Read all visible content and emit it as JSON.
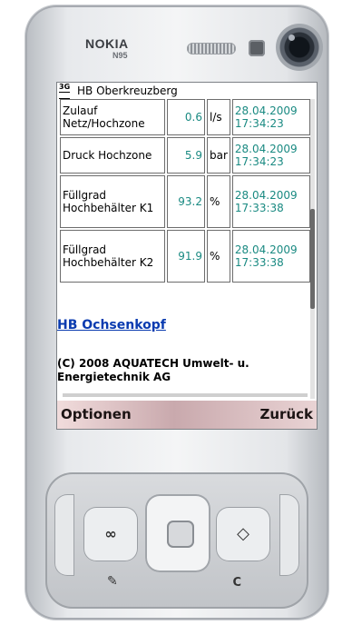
{
  "device": {
    "brand": "NOKIA",
    "model": "N95"
  },
  "screen": {
    "network_label": "3G",
    "title": "HB Oberkreuzberg",
    "rows": [
      {
        "name": "Zulauf Netz/Hochzone",
        "value": "0.6",
        "unit": "l/s",
        "timestamp": "28.04.2009 17:34:23"
      },
      {
        "name": "Druck Hochzone",
        "value": "5.9",
        "unit": "bar",
        "timestamp": "28.04.2009 17:34:23"
      },
      {
        "name": "Füllgrad Hochbehälter K1",
        "value": "93.2",
        "unit": "%",
        "timestamp": "28.04.2009 17:33:38"
      },
      {
        "name": "Füllgrad Hochbehälter K2",
        "value": "91.9",
        "unit": "%",
        "timestamp": "28.04.2009 17:33:38"
      }
    ],
    "link": "HB Ochsenkopf",
    "copyright": "(C) 2008 AQUATECH Umwelt- u. Energietechnik AG",
    "scroll_position": 0.55,
    "softkeys": {
      "left": "Optionen",
      "right": "Zurück"
    }
  },
  "keypad": {
    "clear_key": "C"
  },
  "colors": {
    "value_color": "#1a8a82",
    "link_color": "#0a3bb0",
    "softkey_bar": "#c9a9ad"
  }
}
